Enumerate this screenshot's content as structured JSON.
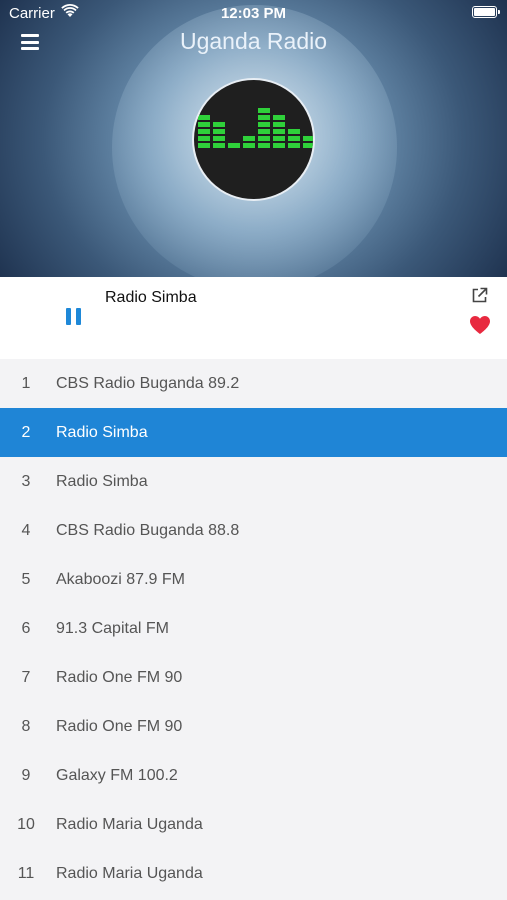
{
  "status": {
    "carrier": "Carrier",
    "time": "12:03 PM"
  },
  "header": {
    "title": "Uganda Radio"
  },
  "player": {
    "now_playing": "Radio Simba",
    "state": "playing",
    "favorite": true
  },
  "colors": {
    "accent": "#1f85d6",
    "favorite": "#e8293f",
    "eq_bars": "#2fd13a"
  },
  "icons": {
    "menu": "hamburger-icon",
    "pause": "pause-icon",
    "share": "external-link-icon",
    "favorite": "heart-icon",
    "wifi": "wifi-icon",
    "battery": "battery-icon"
  },
  "stations": [
    {
      "num": "1",
      "name": "CBS Radio Buganda 89.2"
    },
    {
      "num": "2",
      "name": "Radio Simba"
    },
    {
      "num": "3",
      "name": "Radio Simba"
    },
    {
      "num": "4",
      "name": "CBS Radio Buganda 88.8"
    },
    {
      "num": "5",
      "name": "Akaboozi 87.9 FM"
    },
    {
      "num": "6",
      "name": "91.3 Capital FM"
    },
    {
      "num": "7",
      "name": "Radio One FM 90"
    },
    {
      "num": "8",
      "name": "Radio One FM 90"
    },
    {
      "num": "9",
      "name": "Galaxy FM 100.2"
    },
    {
      "num": "10",
      "name": "Radio Maria Uganda"
    },
    {
      "num": "11",
      "name": "Radio Maria Uganda"
    }
  ],
  "selected_index": 1
}
